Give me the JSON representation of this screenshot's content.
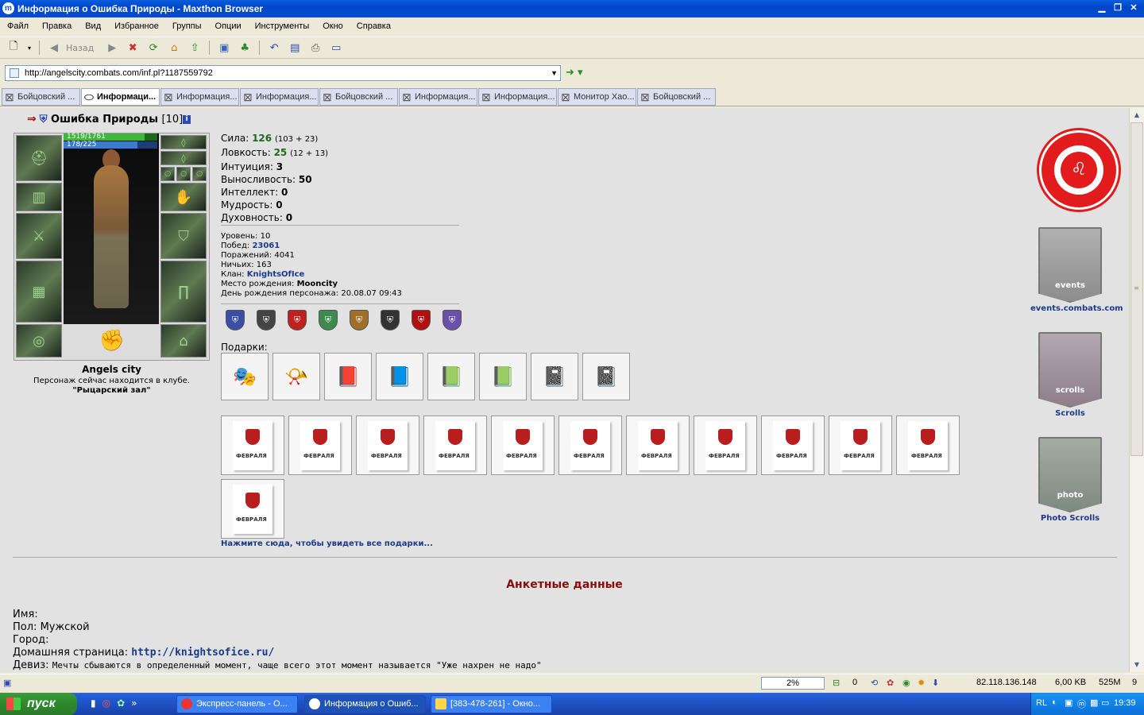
{
  "window": {
    "title": "Информация о Ошибка Природы - Maxthon Browser",
    "app_icon": "m"
  },
  "menu": [
    "Файл",
    "Правка",
    "Вид",
    "Избранное",
    "Группы",
    "Опции",
    "Инструменты",
    "Окно",
    "Справка"
  ],
  "toolbar": {
    "back_label": "Назад"
  },
  "address": {
    "url": "http://angelscity.combats.com/inf.pl?1187559792"
  },
  "tabs": [
    {
      "label": "Бойцовский ...",
      "active": false
    },
    {
      "label": "Информаци...",
      "active": true
    },
    {
      "label": "Информация...",
      "active": false
    },
    {
      "label": "Информация...",
      "active": false
    },
    {
      "label": "Бойцовский ...",
      "active": false
    },
    {
      "label": "Информация...",
      "active": false
    },
    {
      "label": "Информация...",
      "active": false
    },
    {
      "label": "Монитор Хао...",
      "active": false
    },
    {
      "label": "Бойцовский ...",
      "active": false
    }
  ],
  "character": {
    "name": "Ошибка Природы",
    "level": "[10]",
    "hp": "1519/1761",
    "hp_fraction": 0.862,
    "mana": "178/225",
    "mana_fraction": 0.791,
    "city": "Angels city",
    "location_line": "Персонаж сейчас находится в клубе.",
    "location_room": "\"Рыцарский зал\""
  },
  "stats": {
    "strength_label": "Сила:",
    "strength_value": "126",
    "strength_detail": "(103 + 23)",
    "agility_label": "Ловкость:",
    "agility_value": "25",
    "agility_detail": "(12 + 13)",
    "intuition_label": "Интуиция:",
    "intuition_value": "3",
    "endurance_label": "Выносливость:",
    "endurance_value": "50",
    "intellect_label": "Интеллект:",
    "intellect_value": "0",
    "wisdom_label": "Мудрость:",
    "wisdom_value": "0",
    "spirit_label": "Духовность:",
    "spirit_value": "0"
  },
  "info": {
    "level_label": "Уровень:",
    "level_value": "10",
    "wins_label": "Побед:",
    "wins_value": "23061",
    "losses_label": "Поражений:",
    "losses_value": "4041",
    "draws_label": "Ничьих:",
    "draws_value": "163",
    "clan_label": "Клан:",
    "clan_value": "KnightsOfIce",
    "birthplace_label": "Место рождения:",
    "birthplace_value": "Mooncity",
    "birthday_label": "День рождения персонажа:",
    "birthday_value": "20.08.07 09:43"
  },
  "badges": [
    {
      "color": "#3a4ea8",
      "icon": "shield-icon"
    },
    {
      "color": "#444444",
      "icon": "shield-icon"
    },
    {
      "color": "#c02020",
      "icon": "shield-icon"
    },
    {
      "color": "#3e8a4e",
      "icon": "shield-icon"
    },
    {
      "color": "#a0702a",
      "icon": "shield-icon"
    },
    {
      "color": "#333333",
      "icon": "shield-icon"
    },
    {
      "color": "#b01010",
      "icon": "shield-icon"
    },
    {
      "color": "#6a50a8",
      "icon": "shield-icon"
    }
  ],
  "gifts_label": "Подарки:",
  "gifts_row1": [
    {
      "icon": "jester-hat-icon",
      "glyph": "🎭"
    },
    {
      "icon": "horn-icon",
      "glyph": "📯"
    },
    {
      "icon": "red-book-icon",
      "glyph": "📕"
    },
    {
      "icon": "dark-book-icon",
      "glyph": "📘"
    },
    {
      "icon": "teal-book-icon",
      "glyph": "📗"
    },
    {
      "icon": "green-book-icon",
      "glyph": "📗"
    },
    {
      "icon": "purple-book-icon",
      "glyph": "📓"
    },
    {
      "icon": "violet-book-icon",
      "glyph": "📓"
    }
  ],
  "feb_card_text": "ФЕВРАЛЯ",
  "feb_card_count": 12,
  "all_gifts_link": "Нажмите сюда, чтобы увидеть все подарки...",
  "anketa_title": "Анкетные данные",
  "profile": {
    "name_label": "Имя:",
    "gender_label": "Пол:",
    "gender_value": "Мужской",
    "city_label": "Город:",
    "homepage_label": "Домашняя страница:",
    "homepage_value": "http://knightsofice.ru/",
    "motto_label": "Девиз:",
    "motto_value": "Мечты сбываются в определенный момент, чаще всего этот момент называется \"Уже нахрен не надо\""
  },
  "right_links": {
    "events_flag": "events",
    "events_caption": "events.combats.com",
    "scrolls_flag": "scrolls",
    "scrolls_caption": "Scrolls",
    "photo_flag": "photo",
    "photo_caption": "Photo Scrolls"
  },
  "statusbar": {
    "progress": "2%",
    "count": "0",
    "ip": "82.118.136.148",
    "size": "6,00 KB",
    "mem": "525M",
    "num": "9"
  },
  "taskbar": {
    "start_label": "пуск",
    "tasks": [
      {
        "label": "Экспресс-панель - О...",
        "active": false
      },
      {
        "label": "Информация о Ошиб...",
        "active": true
      },
      {
        "label": "[383-478-261] - Окно...",
        "active": false
      }
    ],
    "lang": "RL",
    "clock": "19:39"
  }
}
